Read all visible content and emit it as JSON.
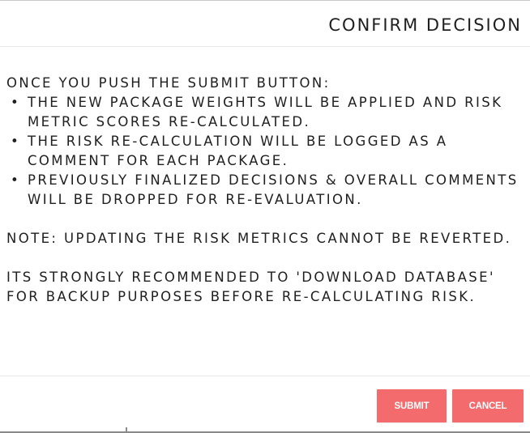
{
  "dialog": {
    "title": "CONFIRM DECISION",
    "intro": "ONCE YOU PUSH THE SUBMIT BUTTON:",
    "bullet_glyph": "•",
    "points": [
      "THE NEW PACKAGE WEIGHTS WILL BE APPLIED AND RISK METRIC SCORES RE-CALCULATED.",
      "THE RISK RE-CALCULATION WILL BE LOGGED AS A COMMENT FOR EACH PACKAGE.",
      "PREVIOUSLY FINALIZED DECISIONS & OVERALL COMMENTS WILL BE DROPPED FOR RE-EVALUATION."
    ],
    "note": "NOTE: UPDATING THE RISK METRICS CANNOT BE REVERTED.",
    "recommendation": "ITS STRONGLY RECOMMENDED TO 'DOWNLOAD DATABASE' FOR BACKUP PURPOSES BEFORE RE-CALCULATING RISK.",
    "submit_label": "SUBMIT",
    "cancel_label": "CANCEL"
  },
  "colors": {
    "button": "#f46b6e",
    "button_text": "#ffffff",
    "text": "#1f1f1f",
    "divider": "#e6e6e6"
  }
}
